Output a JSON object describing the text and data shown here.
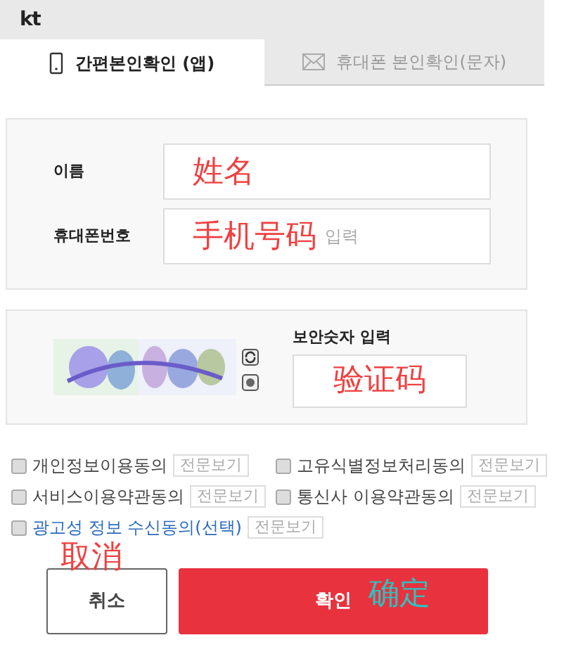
{
  "header": {
    "logo": "kt"
  },
  "tabs": [
    {
      "label": "간편본인확인 (앱)",
      "selected": true,
      "kind": "phone"
    },
    {
      "label": "휴대폰 본인확인(문자)",
      "selected": false,
      "kind": "mail"
    }
  ],
  "form": {
    "fields": [
      {
        "label": "이름",
        "annotation": "姓名"
      },
      {
        "label": "휴대폰번호",
        "annotation": "手机号码",
        "placeholder": "입력"
      }
    ]
  },
  "captcha": {
    "label": "보안숫자 입력",
    "annotation": "验证码"
  },
  "agreements": [
    {
      "label": "개인정보이용동의",
      "checked": false,
      "optional": false,
      "view": "전문보기"
    },
    {
      "label": "고유식별정보처리동의",
      "checked": false,
      "optional": false,
      "view": "전문보기"
    },
    {
      "label": "서비스이용약관동의",
      "checked": false,
      "optional": false,
      "view": "전문보기"
    },
    {
      "label": "통신사 이용약관동의",
      "checked": false,
      "optional": false,
      "view": "전문보기"
    },
    {
      "label": "광고성 정보 수신동의(선택)",
      "checked": false,
      "optional": true,
      "view": "전문보기"
    }
  ],
  "buttons": [
    {
      "label": "취소",
      "kind": "cancel",
      "annotation": "取消"
    },
    {
      "label": "확인",
      "kind": "confirm",
      "annotation": "确定"
    }
  ]
}
